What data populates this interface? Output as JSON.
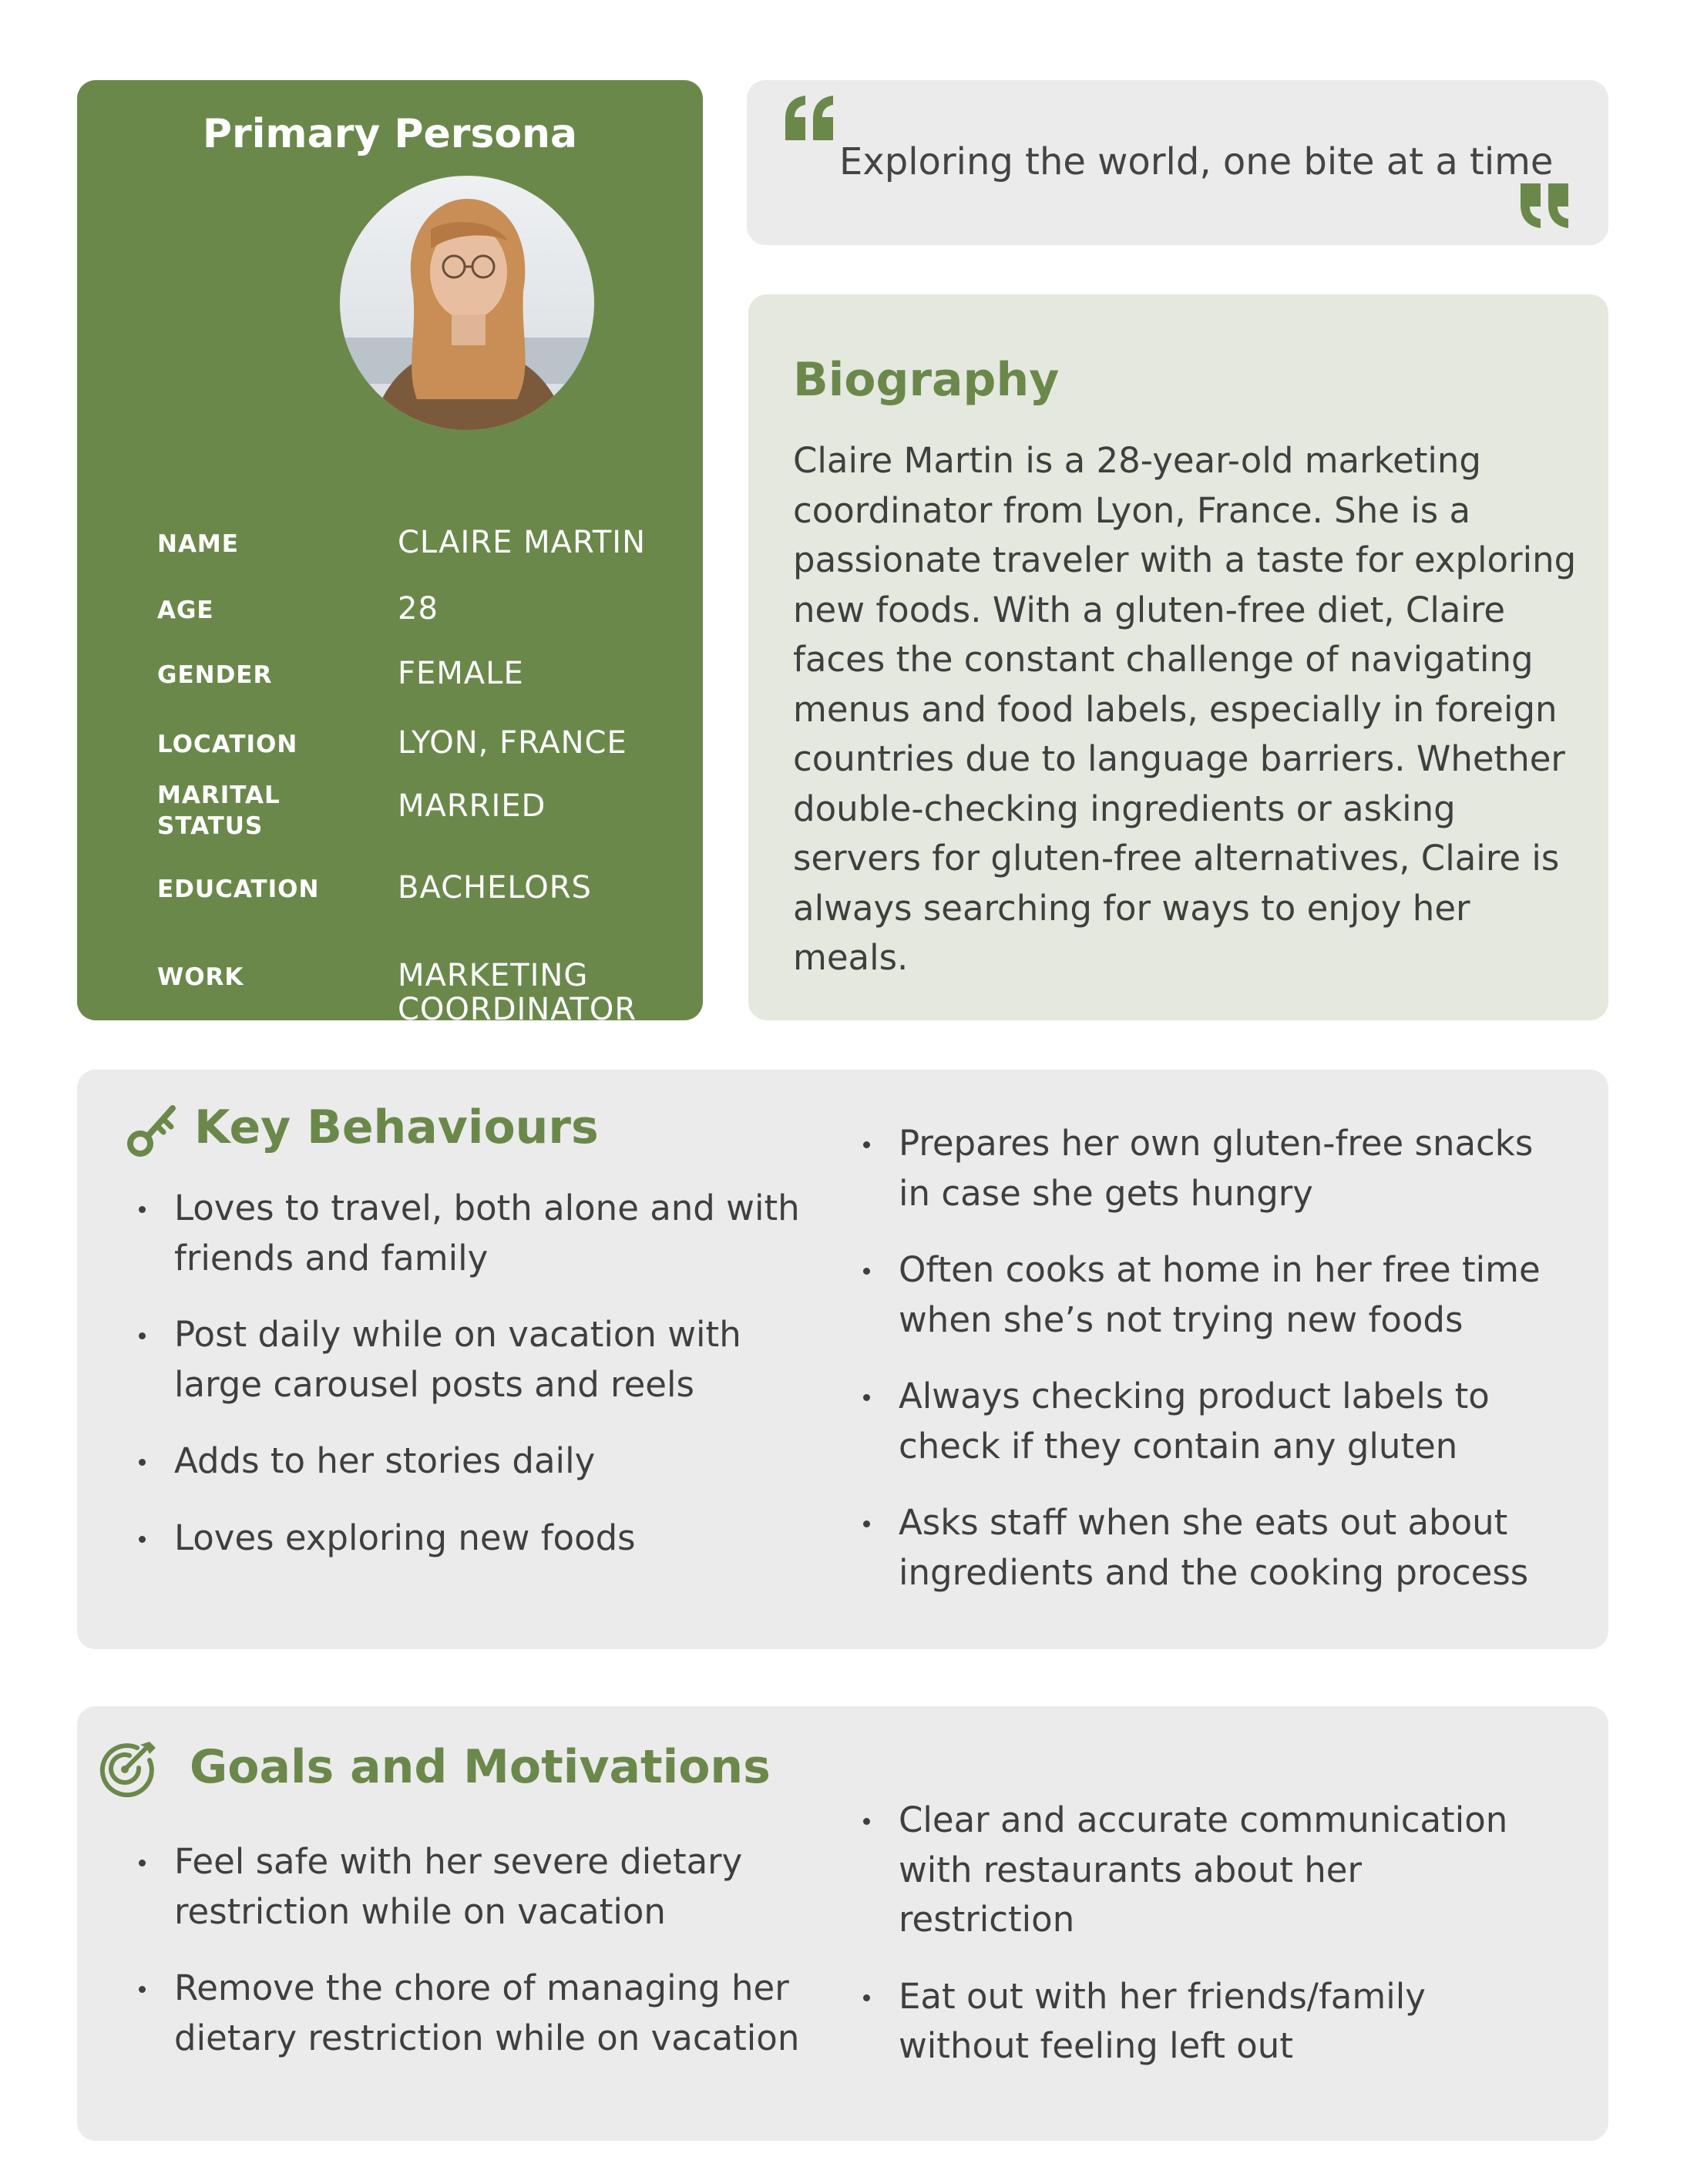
{
  "persona": {
    "title": "Primary Persona",
    "fields": [
      {
        "label": "NAME",
        "value": "CLAIRE MARTIN"
      },
      {
        "label": "AGE",
        "value": "28"
      },
      {
        "label": "GENDER",
        "value": "FEMALE"
      },
      {
        "label": "LOCATION",
        "value": "LYON, FRANCE"
      },
      {
        "label": "MARITAL STATUS",
        "value": "MARRIED"
      },
      {
        "label": "EDUCATION",
        "value": "BACHELORS"
      },
      {
        "label": "WORK",
        "value": "MARKETING COORDINATOR"
      }
    ]
  },
  "quote": {
    "text": "Exploring the world, one bite at a time"
  },
  "biography": {
    "title": "Biography",
    "text": "Claire Martin is a 28-year-old marketing coordinator from Lyon, France. She is a passionate traveler with a taste for exploring new foods. With a gluten-free diet, Claire faces the constant challenge of navigating menus and food labels, especially in foreign countries due to language barriers. Whether double-checking ingredients or asking servers for gluten-free alternatives, Claire is always searching for ways to enjoy her meals."
  },
  "behaviours": {
    "title": "Key Behaviours",
    "left": [
      "Loves to travel, both alone and with friends and family",
      "Post daily while on vacation with large carousel posts and reels",
      "Adds to her stories daily",
      "Loves exploring new foods"
    ],
    "right": [
      "Prepares her own gluten-free snacks in case she gets hungry",
      "Often cooks at home in her free time when she’s not trying new foods",
      "Always checking product labels to check if they contain any gluten",
      "Asks staff when she eats out about ingredients and the cooking process"
    ]
  },
  "goals": {
    "title": "Goals and Motivations",
    "left": [
      "Feel safe with her severe dietary restriction while on vacation",
      "Remove the chore of managing her dietary restriction while on vacation"
    ],
    "right": [
      "Clear and accurate communication with restaurants about her restriction",
      "Eat out with her friends/family without feeling left out"
    ]
  },
  "colors": {
    "accent": "#6b884b",
    "card_gray": "#ebebeb",
    "bio_bg": "#e4e8df"
  },
  "icons": {
    "behaviours": "key-icon",
    "goals": "target-icon",
    "quote_open": "open-quote-icon",
    "quote_close": "close-quote-icon"
  }
}
